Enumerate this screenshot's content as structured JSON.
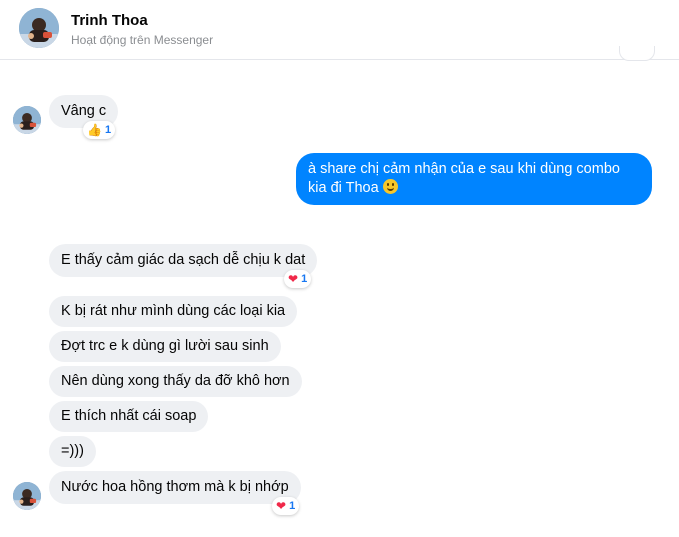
{
  "contact": {
    "name": "Trinh Thoa",
    "status": "Hoạt động trên Messenger"
  },
  "messages": [
    {
      "direction": "incoming",
      "text": "Vâng c",
      "reaction": {
        "icon": "thumbs-up-icon",
        "count": "1"
      }
    },
    {
      "direction": "outgoing",
      "text": "à share chị cảm nhận của e sau khi dùng combo kia đi Thoa",
      "emoji": "grinning-face-icon"
    },
    {
      "direction": "incoming",
      "text": "E thấy cảm giác da sạch dễ chịu k dat",
      "reaction": {
        "icon": "heart-icon",
        "count": "1"
      }
    },
    {
      "direction": "incoming",
      "text": "K bị rát như mình dùng các loại kia"
    },
    {
      "direction": "incoming",
      "text": "Đợt trc e k dùng gì lười sau sinh"
    },
    {
      "direction": "incoming",
      "text": "Nên dùng xong thấy da đỡ khô hơn"
    },
    {
      "direction": "incoming",
      "text": "E thích nhất cái soap"
    },
    {
      "direction": "incoming",
      "text": "=)))"
    },
    {
      "direction": "incoming",
      "text": "Nước hoa hồng thơm mà k bị nhớp",
      "reaction": {
        "icon": "heart-icon",
        "count": "1"
      }
    }
  ],
  "colors": {
    "outgoing_bubble": "#0084ff",
    "incoming_bubble": "#eef0f3",
    "heart": "#f02849"
  }
}
